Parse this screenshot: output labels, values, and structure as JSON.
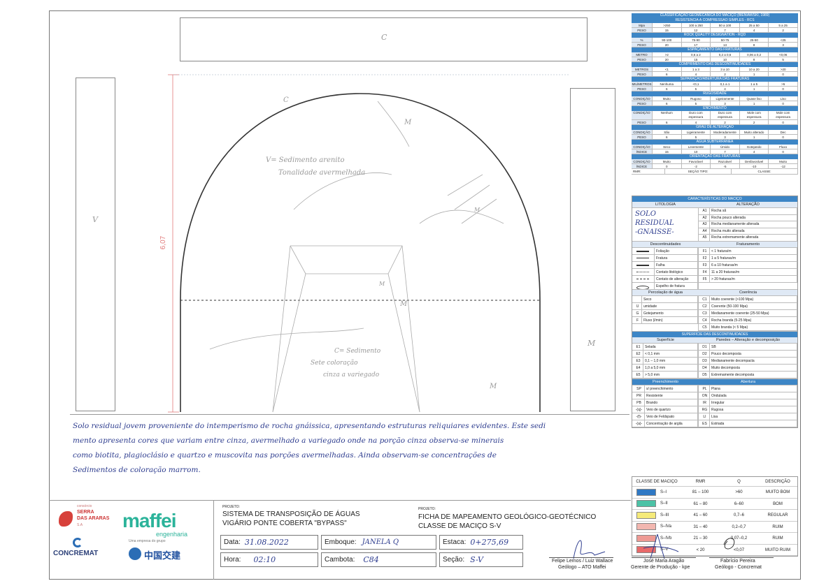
{
  "drawing": {
    "top_label": "C",
    "left_label": "V",
    "right_label": "M",
    "height_dim": "6,07",
    "arch_note_1": "V= Sedimento arenito",
    "arch_note_2": "Tonalidade avermelhada",
    "floor_note_1": "C= Sedimento",
    "floor_note_2": "Sete coloração",
    "floor_note_3": "cinza a variegado",
    "marks": [
      "C",
      "M",
      "M",
      "M",
      "M",
      "M"
    ]
  },
  "panel": {
    "rmr_title": "CLASSIFICAÇÃO GEOMECÂNICA DO MACIÇO (BIENIAWSKI, 1989)",
    "rmr_sections": [
      {
        "header": "RESISTÊNCIA À COMPRESSÃO SIMPLES - RCS",
        "rows": [
          [
            "Mpa",
            ">250",
            "100 a 250",
            "50 a 100",
            "25 a 50",
            "5 a 25"
          ],
          [
            "PESO",
            "15",
            "12",
            "7",
            "4",
            "2"
          ]
        ]
      },
      {
        "header": "ROCK QUALITY DESIGNATION - RQD",
        "rows": [
          [
            "%",
            "90-100",
            "75-90",
            "50-75",
            "25-50",
            "<25"
          ],
          [
            "PESO",
            "20",
            "17",
            "13",
            "8",
            "3"
          ]
        ]
      },
      {
        "header": "ESPAÇAMENTO DAS FRATURAS",
        "rows": [
          [
            "METRO",
            ">2",
            "0,6 a 2",
            "0,2 a 0,6",
            "0,06 a 0,2",
            "<0,06"
          ],
          [
            "PESO",
            "20",
            "15",
            "10",
            "8",
            "5"
          ]
        ]
      },
      {
        "header": "COMPRIMENTO DAS DESCONTINUIDADES",
        "rows": [
          [
            "METROS",
            "<1",
            "1 a 3",
            "3 a 10",
            "10 a 20",
            ">20"
          ],
          [
            "PESO",
            "6",
            "4",
            "2",
            "1",
            "0"
          ]
        ]
      },
      {
        "header": "SEPARAÇÃO/ABERTURA DAS FRATURAS",
        "rows": [
          [
            "MILÍMETROS",
            "Nenhuma",
            "<0,1",
            "0,1 a 1",
            "1 a 5",
            ">5"
          ],
          [
            "PESO",
            "6",
            "5",
            "4",
            "1",
            "0"
          ]
        ]
      },
      {
        "header": "RUGOSIDADE",
        "rows": [
          [
            "CONDIÇÃO",
            "Muito",
            "Rugoso",
            "Ligeiramente",
            "Quase liso",
            "Liso"
          ],
          [
            "PESO",
            "6",
            "5",
            "3",
            "1",
            "0"
          ]
        ]
      },
      {
        "header": "ENCHIMENTO",
        "tall": true,
        "rows": [
          [
            "CONDIÇÃO",
            "Nenhum",
            "Duro com espessura",
            "Duro com espessura",
            "Mole com espessura",
            "Mole com espessura"
          ],
          [
            "PESO",
            "6",
            "4",
            "2",
            "2",
            "0"
          ]
        ]
      },
      {
        "header": "GRAU DE ALTERAÇÃO",
        "rows": [
          [
            "CONDIÇÃO",
            "São",
            "Ligeiramente",
            "Moderadamente",
            "Muito alterado",
            "Dec"
          ],
          [
            "PESO",
            "6",
            "5",
            "3",
            "1",
            "0"
          ]
        ]
      },
      {
        "header": "ÁGUA SUBTERRÂNEA",
        "rows": [
          [
            "CONDIÇÃO",
            "Seco",
            "Levemente",
            "Úmido",
            "Gotejando",
            "Fluxo"
          ],
          [
            "ÍNDICE",
            "15",
            "10",
            "7",
            "4",
            "0"
          ]
        ]
      },
      {
        "header": "ORIENTAÇÃO DAS FRATURAS",
        "rows": [
          [
            "CONDIÇÃO",
            "Muito",
            "Favorável",
            "Razoável",
            "Desfavorável",
            "Muito"
          ],
          [
            "ÍNDICE",
            "0",
            "-2",
            "-5",
            "-10",
            "-12"
          ]
        ]
      }
    ],
    "rmr_footer": [
      "RMR:",
      "SEÇÃO TIPO:",
      "CLASSE:"
    ],
    "maciço_title": "CARACTERÍSTICAS DO MACIÇO",
    "litologia_label": "LITOLOGIA",
    "alteracao_label": "ALTERAÇÃO",
    "litologia_hand": [
      "SOLO",
      "RESIDUAL",
      "-GNAISSE-"
    ],
    "alteracao": [
      [
        "A1",
        "Rocha sã"
      ],
      [
        "A2",
        "Rocha pouco alterada"
      ],
      [
        "A3",
        "Rocha medianamente alterada"
      ],
      [
        "A4",
        "Rocha muito alterada"
      ],
      [
        "A5",
        "Rocha extremamente alterada"
      ]
    ],
    "descont_label": "Descontinuidades",
    "fraturamento_label": "Fraturamento",
    "descontinuidades": [
      "Foliação",
      "Fratura",
      "Falha",
      "Contato litológico",
      "Contato de alteração",
      "Espelho de fratura"
    ],
    "fraturamento": [
      [
        "F1",
        "< 1 fratura/m"
      ],
      [
        "F2",
        "1 a 5 fraturas/m"
      ],
      [
        "F3",
        "6 a 10 fraturas/m"
      ],
      [
        "F4",
        "11 a 20 fraturas/m"
      ],
      [
        "F5",
        "> 20 fraturas/m"
      ]
    ],
    "percolacao_label": "Percolação de água",
    "coerencia_label": "Coerência",
    "percolacao": [
      [
        "",
        "Seco"
      ],
      [
        "U",
        "umidade"
      ],
      [
        "G",
        "Gotejamento"
      ],
      [
        "F",
        "Fluxo (l/min)"
      ]
    ],
    "coerencia": [
      [
        "C1",
        "Muito coerente (>100 Mpa)"
      ],
      [
        "C2",
        "Coerente (50-100 Mpa)"
      ],
      [
        "C3",
        "Medianamente coerente (25-50 Mpa)"
      ],
      [
        "C4",
        "Rocha branda (5-25 Mpa)"
      ],
      [
        "C5",
        "Muito branda (< 5 Mpa)"
      ]
    ],
    "superficie_title": "SUPERFÍCIE DAS DESCONTINUIDADES",
    "superficie_label": "Superfície",
    "paredes_label": "Paredes – Alteração e decomposição",
    "superficie": [
      [
        "E1",
        "Selada"
      ],
      [
        "E2",
        "< 0,1 mm"
      ],
      [
        "E3",
        "0,1 – 1,0 mm"
      ],
      [
        "E4",
        "1,0 a 5,0 mm"
      ],
      [
        "E5",
        "> 5,0 mm"
      ]
    ],
    "paredes": [
      [
        "D1",
        "SB"
      ],
      [
        "D2",
        "Pouco decomposta"
      ],
      [
        "D3",
        "Medianamente decompacta"
      ],
      [
        "D4",
        "Muito decomposta"
      ],
      [
        "D5",
        "Extremamente decomposta"
      ]
    ],
    "preenchimento_label": "Preenchimento",
    "abertura_label": "Abertura",
    "preenchimento": [
      [
        "SP",
        "s/ preenchimento"
      ],
      [
        "PR",
        "Resistente"
      ],
      [
        "PB",
        "Brando"
      ],
      [
        "-(q)-",
        "Veio de quartzo"
      ],
      [
        "-(f)-",
        "Veio de Feldspato"
      ],
      [
        "-(a)-",
        "Concentração de argila"
      ]
    ],
    "abertura": [
      [
        "PL",
        "Plana"
      ],
      [
        "ON",
        "Ondulada"
      ],
      [
        "IR",
        "Irregular"
      ],
      [
        "RG",
        "Rugosa"
      ],
      [
        "LI",
        "Lisa"
      ],
      [
        "ES",
        "Estriada"
      ]
    ],
    "class_header": [
      "CLASSE DE MACIÇO",
      "RMR",
      "Q",
      "DESCRIÇÃO"
    ],
    "classes": [
      {
        "name": "S–I",
        "rmr": "81 – 100",
        "q": ">60",
        "desc": "MUITO BOM",
        "color": "#2f78c4"
      },
      {
        "name": "S–II",
        "rmr": "61 – 80",
        "q": "6–60",
        "desc": "BOM",
        "color": "#4cc2a6"
      },
      {
        "name": "S–III",
        "rmr": "41 – 60",
        "q": "0,7–6",
        "desc": "REGULAR",
        "color": "#f5ea7a"
      },
      {
        "name": "S–IVa",
        "rmr": "31 – 40",
        "q": "0,2–0,7",
        "desc": "RUIM",
        "color": "#f2b7b0"
      },
      {
        "name": "S–IVb",
        "rmr": "21 – 30",
        "q": "0,07–0,2",
        "desc": "RUIM",
        "color": "#ee9a94"
      },
      {
        "name": "S–V",
        "rmr": "< 20",
        "q": "<0,07",
        "desc": "MUITO RUIM",
        "color": "#e86a6a"
      }
    ]
  },
  "description": [
    "Solo residual jovem proveniente do intemperismo de rocha gnáissica, apresentando estruturas reliquiares evidentes. Este sedi",
    "mento apresenta cores que variam entre  cinza, avermelhado a variegado onde na porção cinza observa-se minerais",
    "como biotita, plagioclásio e quartzo e muscovita nas porções avermelhadas. Ainda observam-se concentrações de",
    "Sedimentos de coloração marrom."
  ],
  "footer": {
    "logo_serra": [
      "consórcio",
      "SERRA",
      "DAS ARARAS",
      "S.A"
    ],
    "logo_maffei": "maffei",
    "logo_maffei_sub": "engenharia",
    "logo_concremat": "CONCREMAT",
    "logo_crcc_sub": "Uma empresa do grupo",
    "logo_crcc": "中国交建",
    "proj_label": "PROJETO:",
    "project_1": "SISTEMA DE TRANSPOSIÇÃO DE ÁGUAS",
    "project_2": "VIGÁRIO PONTE COBERTA  \"BYPASS\"",
    "proj2_label": "PROJETO:",
    "ficha_1": "FICHA DE MAPEAMENTO GEOLÓGICO-GEOTÉCNICO",
    "ficha_2": "CLASSE DE MACIÇO  S-V",
    "data_label": "Data:",
    "data_value": "31.08.2022",
    "hora_label": "Hora:",
    "hora_value": "02:10",
    "emboque_label": "Emboque:",
    "emboque_value": "JANELA Q",
    "cambota_label": "Cambota:",
    "cambota_value": "C84",
    "estaca_label": "Estaca:",
    "estaca_value": "0+275,69",
    "secao_label": "Seção:",
    "secao_value": "S-V",
    "sign_1_name": "Felipe Lemos / Luiz Wallace",
    "sign_1_role": "Geólogo – ATO Maffei",
    "sign_2_name": "José Maria Aragão",
    "sign_2_role": "Gerente de Produção - kpe",
    "sign_3_name": "Fabrício Pereira",
    "sign_3_role": "Geólogo - Concremat"
  }
}
